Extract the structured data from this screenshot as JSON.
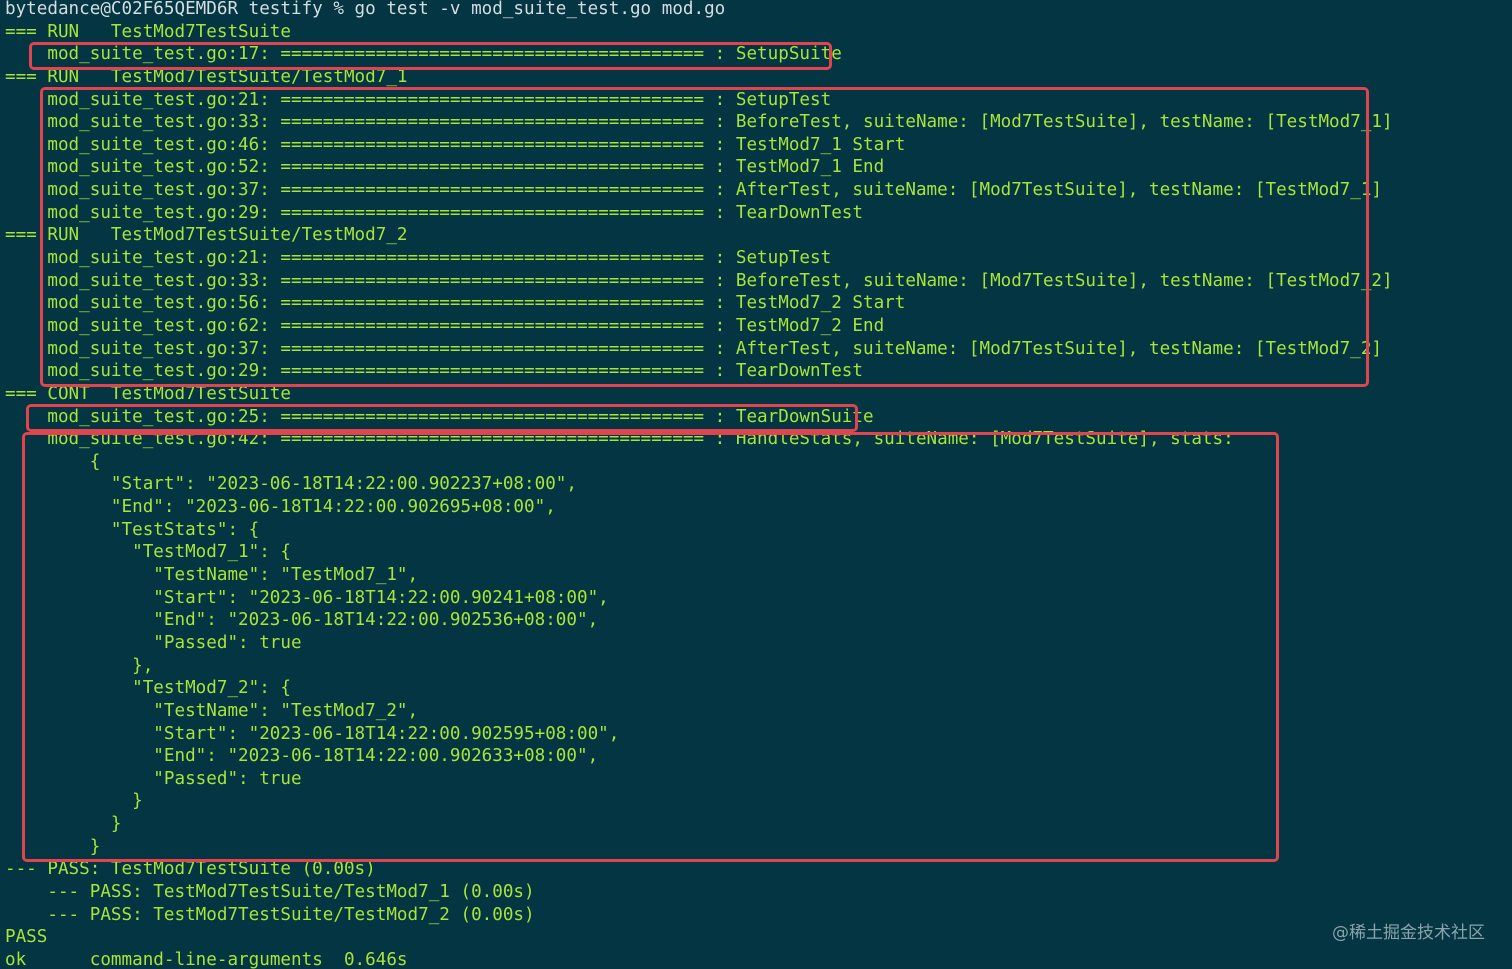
{
  "terminal": {
    "prompt": "bytedance@C02F65QEMD6R testify % go test -v mod_suite_test.go mod.go",
    "lines": [
      "=== RUN   TestMod7TestSuite",
      "    mod_suite_test.go:17: ======================================== : SetupSuite",
      "=== RUN   TestMod7TestSuite/TestMod7_1",
      "    mod_suite_test.go:21: ======================================== : SetupTest",
      "    mod_suite_test.go:33: ======================================== : BeforeTest, suiteName: [Mod7TestSuite], testName: [TestMod7_1]",
      "    mod_suite_test.go:46: ======================================== : TestMod7_1 Start",
      "    mod_suite_test.go:52: ======================================== : TestMod7_1 End",
      "    mod_suite_test.go:37: ======================================== : AfterTest, suiteName: [Mod7TestSuite], testName: [TestMod7_1]",
      "    mod_suite_test.go:29: ======================================== : TearDownTest",
      "=== RUN   TestMod7TestSuite/TestMod7_2",
      "    mod_suite_test.go:21: ======================================== : SetupTest",
      "    mod_suite_test.go:33: ======================================== : BeforeTest, suiteName: [Mod7TestSuite], testName: [TestMod7_2]",
      "    mod_suite_test.go:56: ======================================== : TestMod7_2 Start",
      "    mod_suite_test.go:62: ======================================== : TestMod7_2 End",
      "    mod_suite_test.go:37: ======================================== : AfterTest, suiteName: [Mod7TestSuite], testName: [TestMod7_2]",
      "    mod_suite_test.go:29: ======================================== : TearDownTest",
      "=== CONT  TestMod7TestSuite",
      "    mod_suite_test.go:25: ======================================== : TearDownSuite",
      "    mod_suite_test.go:42: ======================================== : HandleStats, suiteName: [Mod7TestSuite], stats:",
      "        {",
      "          \"Start\": \"2023-06-18T14:22:00.902237+08:00\",",
      "          \"End\": \"2023-06-18T14:22:00.902695+08:00\",",
      "          \"TestStats\": {",
      "            \"TestMod7_1\": {",
      "              \"TestName\": \"TestMod7_1\",",
      "              \"Start\": \"2023-06-18T14:22:00.90241+08:00\",",
      "              \"End\": \"2023-06-18T14:22:00.902536+08:00\",",
      "              \"Passed\": true",
      "            },",
      "            \"TestMod7_2\": {",
      "              \"TestName\": \"TestMod7_2\",",
      "              \"Start\": \"2023-06-18T14:22:00.902595+08:00\",",
      "              \"End\": \"2023-06-18T14:22:00.902633+08:00\",",
      "              \"Passed\": true",
      "            }",
      "          }",
      "        }",
      "--- PASS: TestMod7TestSuite (0.00s)",
      "    --- PASS: TestMod7TestSuite/TestMod7_1 (0.00s)",
      "    --- PASS: TestMod7TestSuite/TestMod7_2 (0.00s)",
      "PASS",
      "ok  \tcommand-line-arguments\t0.646s"
    ]
  },
  "watermark": "@稀土掘金技术社区",
  "colors": {
    "background": "#033542",
    "output_text": "#a8e43a",
    "prompt_text": "#d4dde0",
    "highlight_box": "#e0454f"
  }
}
